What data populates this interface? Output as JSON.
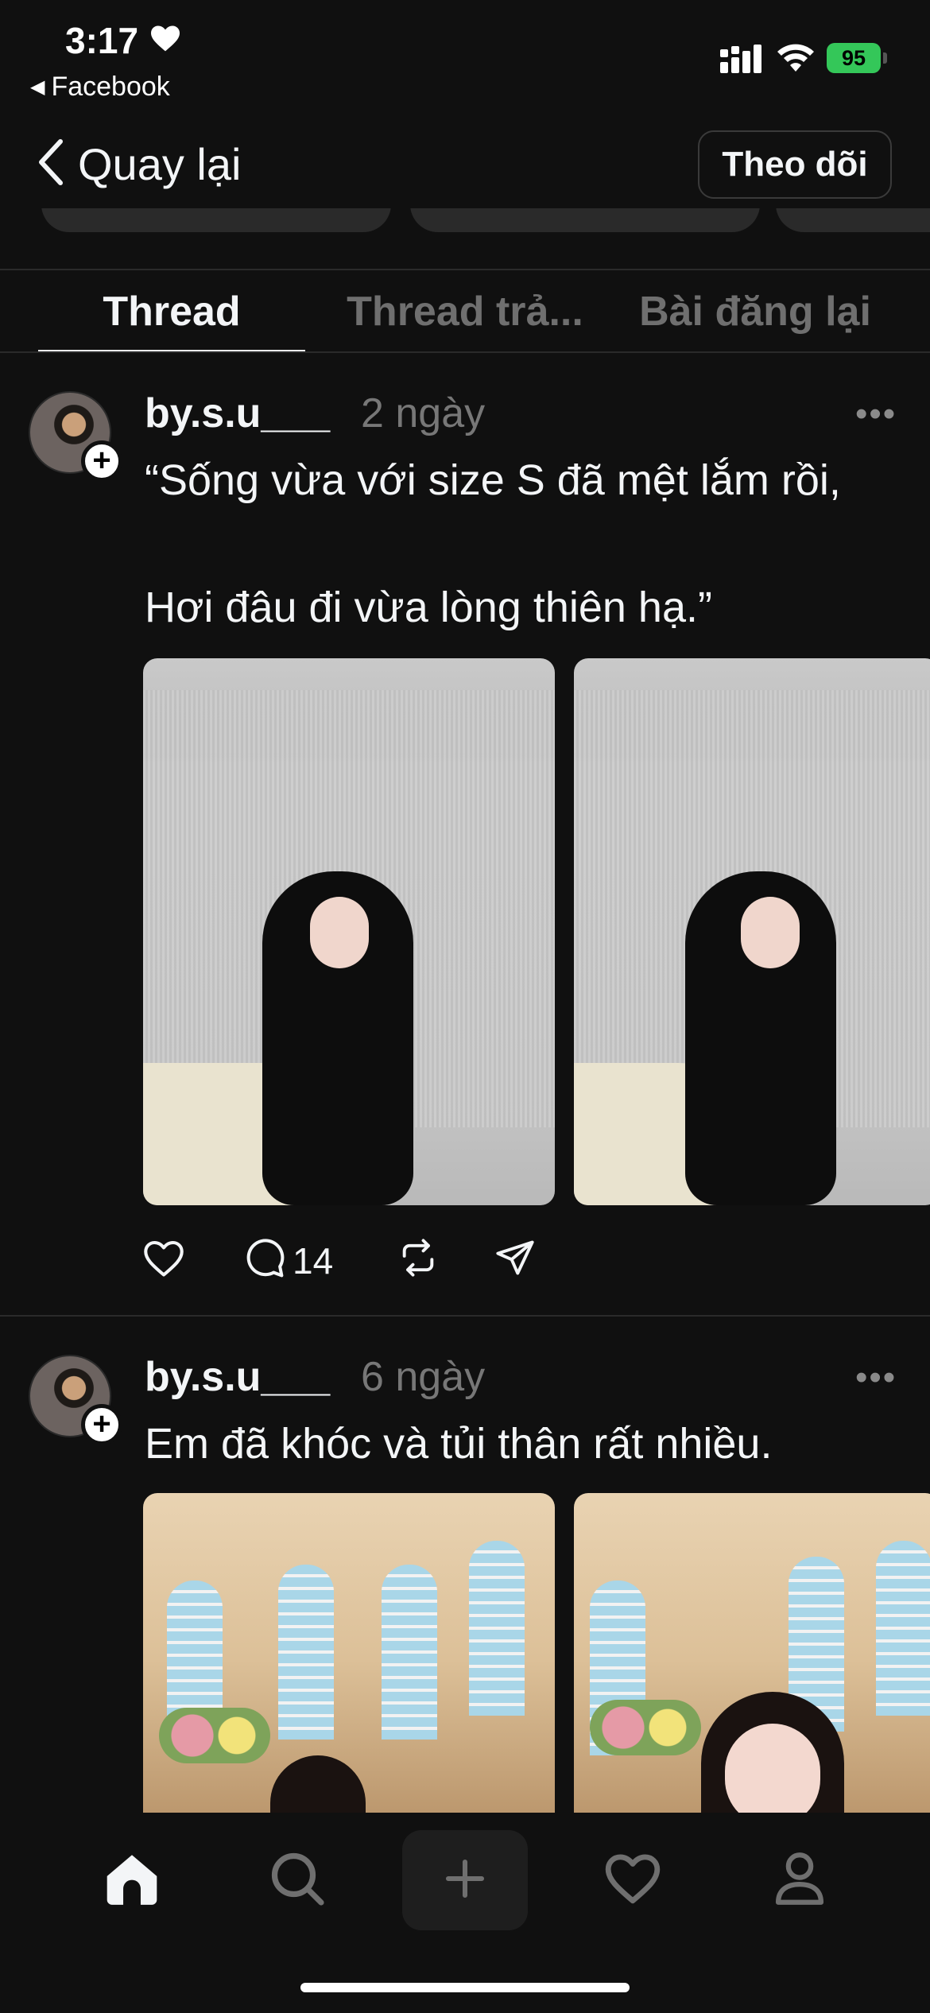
{
  "status_bar": {
    "time": "3:17",
    "back_app": "Facebook",
    "battery": "95"
  },
  "header": {
    "back_label": "Quay lại",
    "follow_label": "Theo dõi"
  },
  "tabs": [
    {
      "label": "Thread",
      "active": true
    },
    {
      "label": "Thread trả...",
      "active": false
    },
    {
      "label": "Bài đăng lại",
      "active": false
    }
  ],
  "posts": [
    {
      "username": "by.s.u___",
      "time": "2 ngày",
      "text": "“Sống vừa với size S đã mệt lắm rồi,\n\nHơi đâu đi vừa lòng thiên hạ.”",
      "reply_count": "14"
    },
    {
      "username": "by.s.u___",
      "time": "6 ngày",
      "text": "Em đã khóc và tủi thân rất nhiều."
    }
  ],
  "colors": {
    "background": "#101010",
    "text": "#f3f5f7",
    "muted": "#777777",
    "battery": "#34c759"
  },
  "icons": {
    "nav": [
      "home-icon",
      "search-icon",
      "plus-icon",
      "heart-icon",
      "profile-icon"
    ],
    "actions": [
      "heart-icon",
      "comment-icon",
      "repost-icon",
      "share-icon"
    ]
  }
}
